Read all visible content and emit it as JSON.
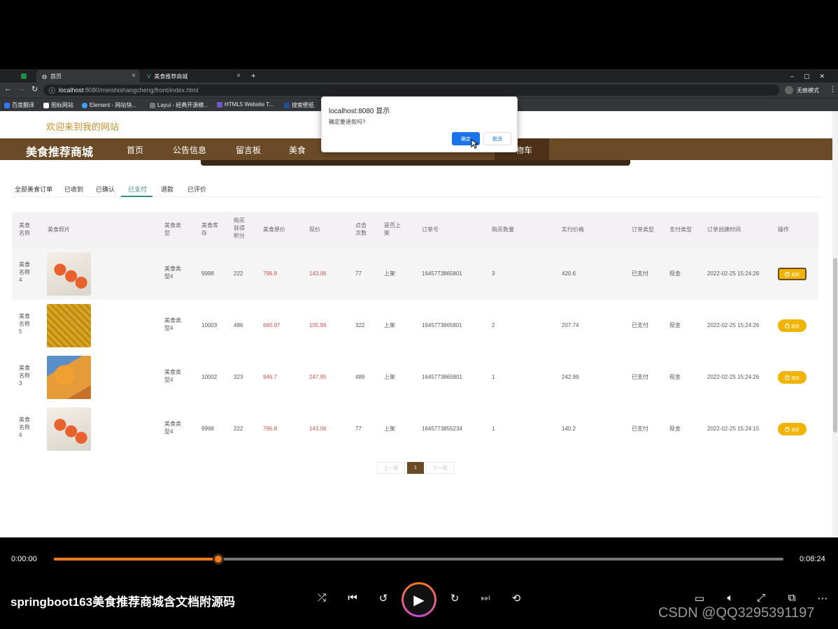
{
  "browser": {
    "tabs": [
      {
        "label": "首页"
      },
      {
        "label": "美食推荐商城"
      }
    ],
    "url_host": "localhost",
    "url_rest": ":8080/meishishangcheng/front/index.html",
    "profile_label": "无痕模式",
    "bookmarks": [
      "百度翻译",
      "图标网站",
      "Element - 网站快...",
      "Layui - 经典开源模...",
      "HTML5 Website T...",
      "搜索壁纸"
    ]
  },
  "site": {
    "welcome": "欢迎来到我的网站",
    "brand": "美食推荐商城",
    "nav": [
      "首页",
      "公告信息",
      "留言板",
      "美食"
    ],
    "nav_cart": "物车"
  },
  "order_tabs": [
    {
      "label": "全部美食订单",
      "active": false
    },
    {
      "label": "已收到",
      "active": false
    },
    {
      "label": "已确认",
      "active": false
    },
    {
      "label": "已支付",
      "active": true
    },
    {
      "label": "退款",
      "active": false
    },
    {
      "label": "已评价",
      "active": false
    }
  ],
  "table": {
    "headers": [
      "美食名称",
      "美食照片",
      "美食类型",
      "美食库存",
      "购买获得积分",
      "美食原价",
      "现价",
      "点击次数",
      "是否上架",
      "订单号",
      "购买数量",
      "实付价格",
      "订单类型",
      "支付类型",
      "订单创建时间",
      "操作"
    ],
    "rows": [
      {
        "name": "美食名称4",
        "photo": "sushi-roll",
        "type": "美食类型4",
        "stock": "9998",
        "points": "222",
        "orig": "796.8",
        "price": "143.06",
        "clicks": "77",
        "listed": "上架",
        "order_no": "1645773865801",
        "qty": "3",
        "paid": "420.6",
        "order_type": "已支付",
        "pay_type": "现金",
        "created": "2022-02-25 15:24:26",
        "action": "退款"
      },
      {
        "name": "美食名称5",
        "photo": "egg-pancake",
        "type": "美食类型4",
        "stock": "10003",
        "points": "486",
        "orig": "660.97",
        "price": "105.99",
        "clicks": "322",
        "listed": "上架",
        "order_no": "1645773865801",
        "qty": "2",
        "paid": "207.74",
        "order_type": "已支付",
        "pay_type": "现金",
        "created": "2022-02-25 15:24:26",
        "action": "退款"
      },
      {
        "name": "美食名称3",
        "photo": "pizza-toast",
        "type": "美食类型4",
        "stock": "10002",
        "points": "323",
        "orig": "946.7",
        "price": "247.95",
        "clicks": "489",
        "listed": "上架",
        "order_no": "1645773865801",
        "qty": "1",
        "paid": "242.99",
        "order_type": "已支付",
        "pay_type": "现金",
        "created": "2022-02-25 15:24:26",
        "action": "退款"
      },
      {
        "name": "美食名称4",
        "photo": "sushi-roll",
        "type": "美食类型4",
        "stock": "9998",
        "points": "222",
        "orig": "796.8",
        "price": "143.06",
        "clicks": "77",
        "listed": "上架",
        "order_no": "1645773855234",
        "qty": "1",
        "paid": "140.2",
        "order_type": "已支付",
        "pay_type": "现金",
        "created": "2022-02-25 15:24:15",
        "action": "退款"
      }
    ]
  },
  "pagination": {
    "prev": "上一页",
    "current": "1",
    "next": "下一页"
  },
  "dialog": {
    "title": "localhost:8080 显示",
    "message": "确定要退款吗?",
    "ok": "确定",
    "cancel": "取消"
  },
  "player": {
    "current_time": "0:00:00",
    "duration": "0:08:24",
    "progress_fraction": 0.225,
    "title": "springboot163美食推荐商城含文档附源码",
    "watermark": "CSDN @QQ3295391197"
  },
  "colors": {
    "brand": "#6b4a27",
    "accent_button": "#f0b400",
    "price": "#d9534f",
    "progress": "#ff7a1a"
  }
}
